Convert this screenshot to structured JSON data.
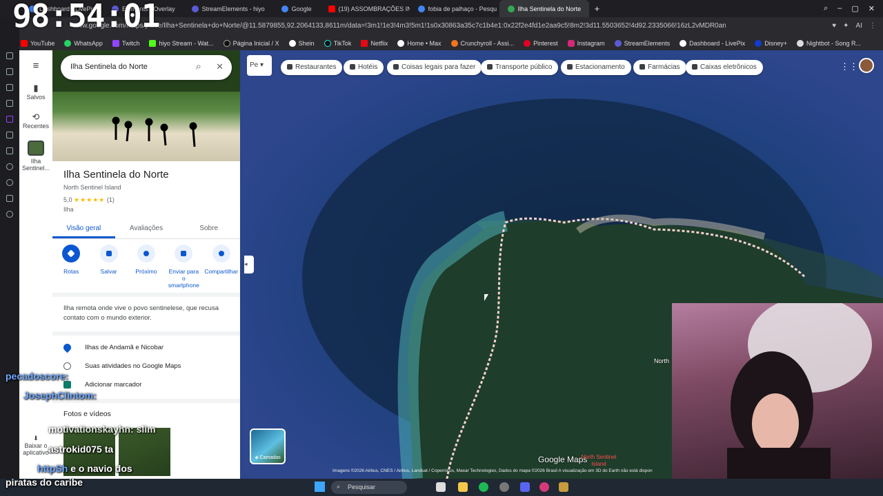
{
  "overlay": {
    "clock": "98:54:01"
  },
  "tabs": [
    {
      "label": "Dashboard - LivePix",
      "color": "#3b82f6"
    },
    {
      "label": "Elements - Overlay",
      "color": "#5b5bd6"
    },
    {
      "label": "StreamElements - hiyo",
      "color": "#5b5bd6"
    },
    {
      "label": "Google",
      "color": "#4285f4"
    },
    {
      "label": "(19) ASSOMBRAÇÕES IN",
      "color": "#ff0000"
    },
    {
      "label": "fobia de palhaço - Pesqu",
      "color": "#4285f4"
    },
    {
      "label": "Ilha Sentinela do Norte",
      "color": "#34a853",
      "active": true
    }
  ],
  "address": {
    "url": "ww.google.com/maps/place/Ilha+Sentinela+do+Norte/@11.5879855,92.2064133,8611m/data=!3m1!1e3!4m3!5m1!1s0x30863a35c7c1b4e1:0x22f2e4fd1e2aa9c5!8m2!3d11.5503652!4d92.2335066!16zL2vMDR0anpf"
  },
  "bookmarks": [
    "YouTube",
    "WhatsApp",
    "Twitch",
    "hiyo Stream - Wat...",
    "Página Inicial / X",
    "Shein",
    "TikTok",
    "Netflix",
    "Home • Max",
    "Crunchyroll - Assi...",
    "Pinterest",
    "Instagram",
    "StreamElements",
    "Dashboard - LivePix",
    "Disney+",
    "Nightbot - Song R..."
  ],
  "rail": {
    "saved": "Salvos",
    "recent": "Recentes",
    "place": "Ilha Sentinel...",
    "download": "Baixar o aplicativo"
  },
  "search": {
    "value": "Ilha Sentinela do Norte"
  },
  "place": {
    "title": "Ilha Sentinela do Norte",
    "subtitle": "North Sentinel Island",
    "rating": "5,0",
    "stars": "★★★★★",
    "count": "(1)",
    "type": "Ilha",
    "tabs": [
      "Visão geral",
      "Avaliações",
      "Sobre"
    ],
    "actions": [
      "Rotas",
      "Salvar",
      "Próximo",
      "Enviar para o smartphone",
      "Compartilhar"
    ],
    "description": "Ilha remota onde vive o povo sentinelese, que recusa contato com o mundo exterior.",
    "rows": [
      "Ilhas de Andamã e Nicobar",
      "Suas atividades no Google Maps",
      "Adicionar marcador"
    ],
    "photos_title": "Fotos e vídeos"
  },
  "chips": [
    "Restaurantes",
    "Hotéis",
    "Coisas legais para fazer",
    "Transporte público",
    "Estacionamento",
    "Farmácias",
    "Caixas eletrônicos"
  ],
  "map": {
    "layers": "Camadas",
    "brand": "Google Maps",
    "label": "North Sentinel Island",
    "label_cut": "North",
    "credit": "Imagens ©2026 Airbus, CNES / Airbus, Landsat / Copernicus, Maxar Technologies, Dados do mapa ©2026    Brasil    A visualização em 3D do Earth não está dispon"
  },
  "chat": [
    {
      "user": "pecadoscore:",
      "msg": ""
    },
    {
      "user": "JosephClintom:",
      "msg": ""
    },
    {
      "user": "",
      "msg": "motivationskayhn: slim"
    },
    {
      "user": "",
      "msg": "astrokid075 ta"
    },
    {
      "user": "httpSh",
      "msg": " e o navio dos"
    },
    {
      "user": "",
      "msg": "piratas do caribe"
    }
  ],
  "taskbar": {
    "search": "Pesquisar"
  }
}
